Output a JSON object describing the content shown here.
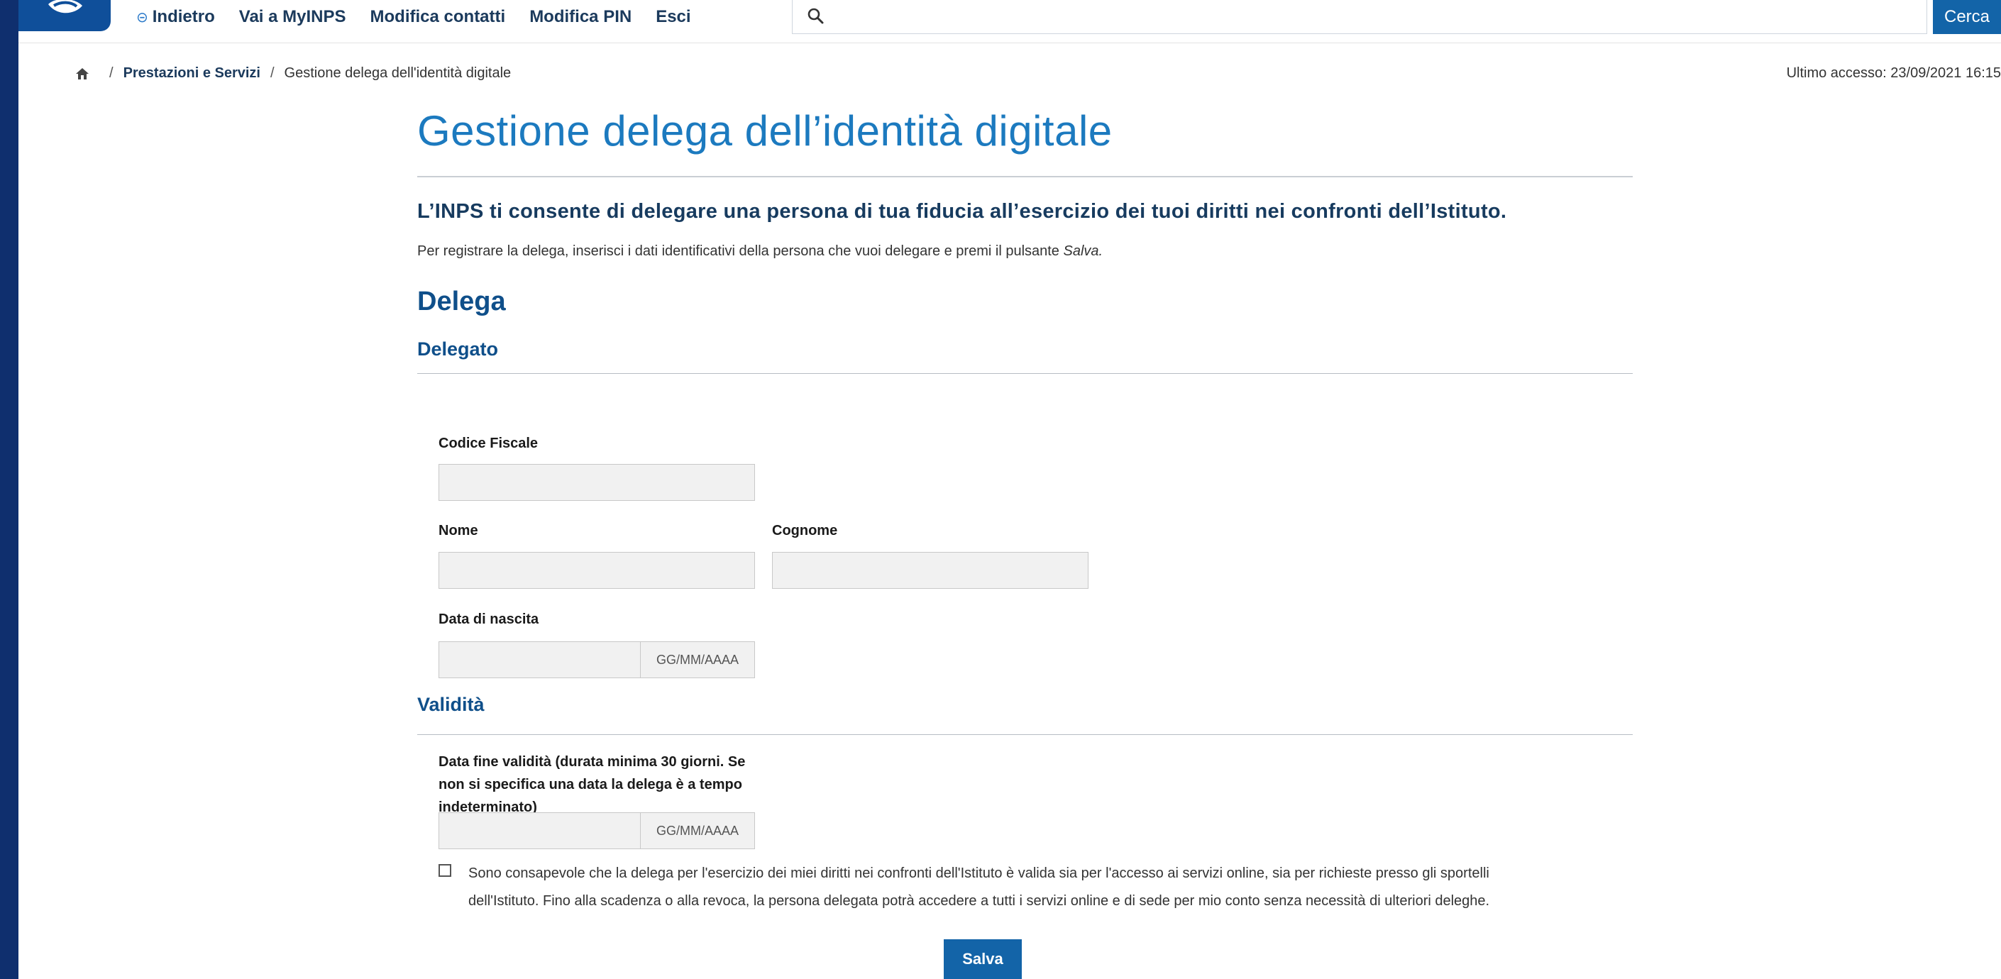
{
  "nav": {
    "back": "Indietro",
    "myinps": "Vai a MyINPS",
    "contacts": "Modifica contatti",
    "pin": "Modifica PIN",
    "exit": "Esci"
  },
  "search": {
    "button": "Cerca",
    "value": ""
  },
  "breadcrumb": {
    "sep": "/",
    "items": [
      "Prestazioni e Servizi",
      "Gestione delega dell'identità digitale"
    ]
  },
  "last_access": "Ultimo accesso: 23/09/2021 16:15",
  "page": {
    "title": "Gestione delega dell’identità digitale",
    "subtitle": "L’INPS ti consente di delegare una persona di tua fiducia all’esercizio dei tuoi diritti nei confronti dell’Istituto.",
    "intro_text": "Per registrare la delega, inserisci i dati identificativi della persona che vuoi delegare e premi il pulsante ",
    "intro_em": "Salva."
  },
  "form": {
    "section": "Delega",
    "delegato": {
      "heading": "Delegato",
      "cf_label": "Codice Fiscale",
      "nome_label": "Nome",
      "cognome_label": "Cognome",
      "dob_label": "Data di nascita",
      "date_placeholder": "GG/MM/AAAA"
    },
    "validita": {
      "heading": "Validità",
      "end_label": "Data fine validità (durata minima 30 giorni. Se non si specifica una data la delega è a tempo indeterminato)",
      "date_placeholder": "GG/MM/AAAA"
    },
    "consent": "Sono consapevole che la delega per l'esercizio dei miei diritti nei confronti dell'Istituto è valida sia per l'accesso ai servizi online, sia per richieste presso gli sportelli dell'Istituto. Fino alla scadenza o alla revoca, la persona delegata potrà accedere a tutti i servizi online e di sede per mio conto senza necessità di ulteriori deleghe.",
    "save": "Salva"
  },
  "icons": {
    "back": "circle-arrow-left-icon",
    "search": "magnifier-icon",
    "home": "home-icon",
    "logo": "inps-logo"
  },
  "colors": {
    "frame": "#0f2f6e",
    "primary": "#1364a8",
    "title": "#1c7abf",
    "heading": "#0f4f8a"
  }
}
